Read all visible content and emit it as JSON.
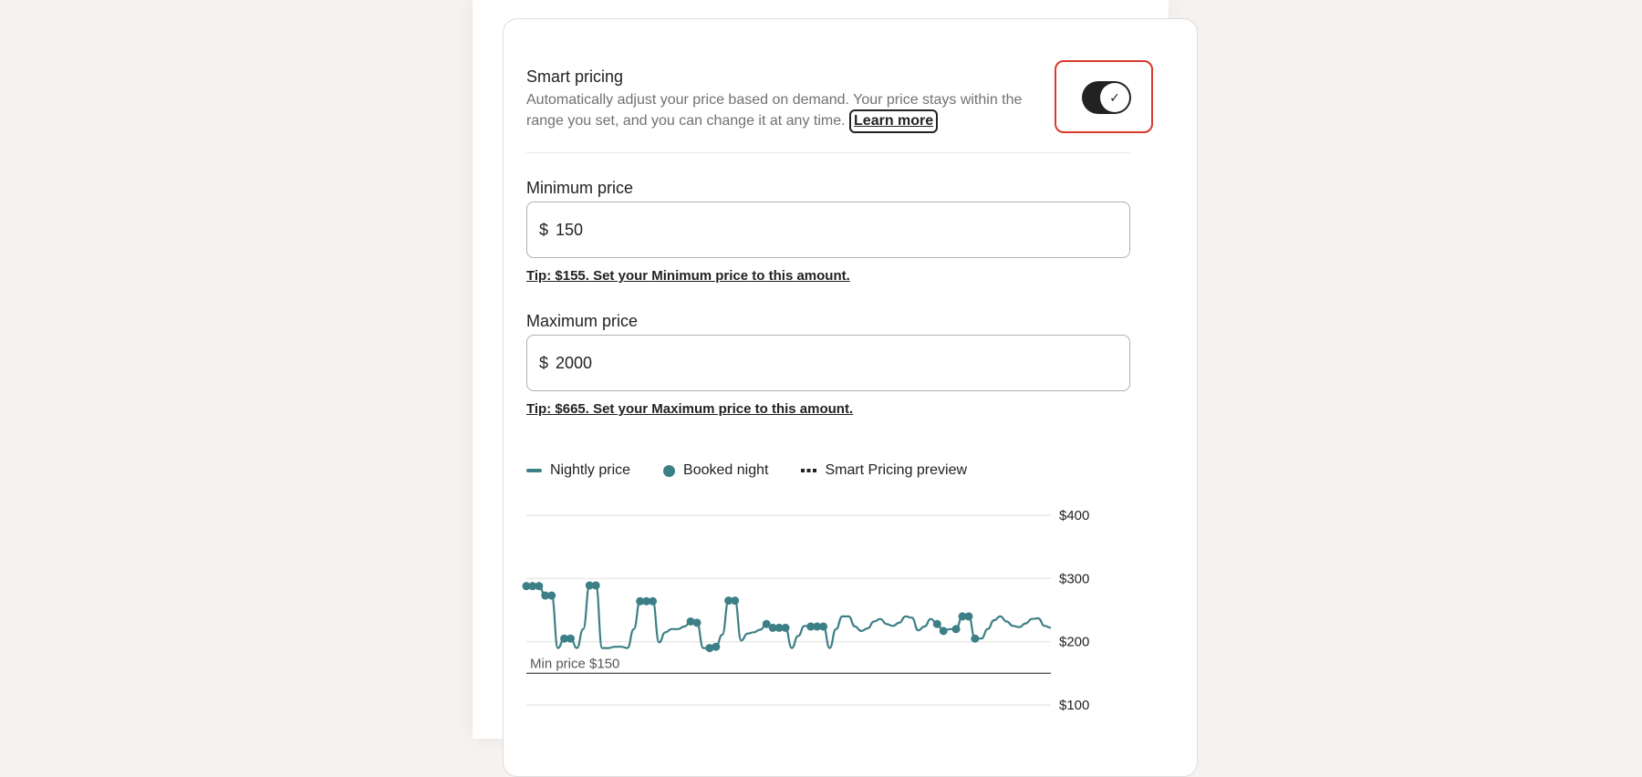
{
  "smart_pricing": {
    "title": "Smart pricing",
    "description": "Automatically adjust your price based on demand. Your price stays within the range you set, and you can change it at any time.",
    "learn_more": "Learn more",
    "toggle_on": true,
    "toggle_check": "✓"
  },
  "minimum_price": {
    "label": "Minimum price",
    "currency": "$",
    "value": "150",
    "tip": "Tip: $155. Set your Minimum price to this amount."
  },
  "maximum_price": {
    "label": "Maximum price",
    "currency": "$",
    "value": "2000",
    "tip": "Tip: $665. Set your Maximum price to this amount."
  },
  "legend": {
    "nightly": "Nightly price",
    "booked": "Booked night",
    "preview": "Smart Pricing preview"
  },
  "colors": {
    "accent": "#3c7f86",
    "focus": "#d93a2b"
  },
  "chart_data": {
    "type": "line",
    "y_ticks": [
      "$400",
      "$300",
      "$200",
      "$100"
    ],
    "ylim": [
      100,
      400
    ],
    "min_line": {
      "label": "Min price $150",
      "value": 150
    },
    "series": [
      {
        "values": [
          288,
          288,
          288,
          273,
          273,
          190,
          205,
          205,
          190,
          220,
          289,
          289,
          190,
          190,
          192,
          192,
          190,
          220,
          264,
          264,
          264,
          199,
          215,
          220,
          220,
          224,
          232,
          230,
          190,
          190,
          192,
          211,
          265,
          265,
          202,
          213,
          215,
          219,
          228,
          222,
          222,
          222,
          190,
          209,
          225,
          224,
          224,
          224,
          190,
          220,
          240,
          240,
          224,
          217,
          221,
          232,
          236,
          228,
          225,
          230,
          240,
          238,
          218,
          224,
          236,
          228,
          217,
          220,
          220,
          240,
          240,
          205,
          205,
          220,
          234,
          240,
          232,
          225,
          223,
          229,
          236,
          237,
          225,
          222
        ]
      }
    ],
    "booked_indices": [
      0,
      1,
      2,
      3,
      4,
      6,
      7,
      10,
      11,
      18,
      19,
      20,
      26,
      27,
      29,
      30,
      32,
      33,
      38,
      39,
      40,
      41,
      45,
      46,
      47,
      65,
      66,
      68,
      69,
      70,
      71
    ]
  }
}
